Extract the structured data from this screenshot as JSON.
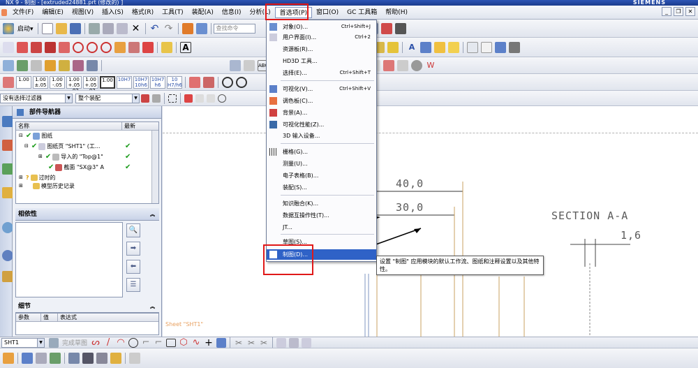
{
  "window": {
    "title": "NX 9 - 制图 - [extruded24881.prt (修改的) ]",
    "brand": "SIEMENS"
  },
  "menubar": [
    {
      "label": "文件(F)"
    },
    {
      "label": "编辑(E)"
    },
    {
      "label": "视图(V)"
    },
    {
      "label": "插入(S)"
    },
    {
      "label": "格式(R)"
    },
    {
      "label": "工具(T)"
    },
    {
      "label": "装配(A)"
    },
    {
      "label": "信息(I)"
    },
    {
      "label": "分析(L)"
    },
    {
      "label": "首选项(P)"
    },
    {
      "label": "窗口(O)"
    },
    {
      "label": "GC 工具箱"
    },
    {
      "label": "帮助(H)"
    }
  ],
  "toolbar1": {
    "start_label": "启动▾",
    "search_placeholder": "查找命令"
  },
  "toolbar3": {
    "dims": [
      "1.00",
      "1.00\n±.05",
      "1.00\n-.05",
      "1.00\n+.05\n-.02",
      "1.00\n+.05\n-.02",
      "1.00",
      "10H7",
      "10H7\n10h6",
      "10H7\nh6",
      "10\nH7/h6"
    ]
  },
  "filterbar": {
    "filter": "没有选择过滤器",
    "scope": "整个装配"
  },
  "navigator": {
    "title": "部件导航器",
    "columns": [
      "名称",
      "最新"
    ],
    "rows": [
      {
        "label": "图纸",
        "latest": ""
      },
      {
        "label": "图纸页 \"SHT1\" (工...",
        "latest": "✔"
      },
      {
        "label": "导入的 \"Top@1\"",
        "latest": "✔"
      },
      {
        "label": "截面 \"SX@3\" A",
        "latest": "✔"
      },
      {
        "label": "过时的",
        "latest": ""
      },
      {
        "label": "模型历史记录",
        "latest": ""
      }
    ]
  },
  "dependencies": {
    "title": "相依性"
  },
  "details": {
    "title": "细节",
    "columns": [
      "参数",
      "值",
      "表达式"
    ]
  },
  "drawing": {
    "dim1": "40,0",
    "dim2": "30,0",
    "section": "SECTION A-A",
    "dim3": "1,6",
    "sheet": "Sheet \"SHT1\""
  },
  "prefs_menu": {
    "items": [
      {
        "label": "对象(O)...",
        "shortcut": "Ctrl+Shift+J",
        "icon": "object-icon"
      },
      {
        "label": "用户界面(I)...",
        "shortcut": "Ctrl+2",
        "icon": "ui-icon"
      },
      {
        "label": "资源板(R)...",
        "shortcut": "",
        "icon": ""
      },
      {
        "label": "HD3D 工具...",
        "shortcut": "",
        "icon": ""
      },
      {
        "label": "选择(E)...",
        "shortcut": "Ctrl+Shift+T",
        "icon": ""
      },
      {
        "label": "可视化(V)...",
        "shortcut": "Ctrl+Shift+V",
        "icon": "visualization-icon"
      },
      {
        "label": "调色板(C)...",
        "shortcut": "",
        "icon": "palette-icon"
      },
      {
        "label": "背景(A)...",
        "shortcut": "",
        "icon": "background-icon"
      },
      {
        "label": "可视化性能(Z)...",
        "shortcut": "",
        "icon": "performance-icon"
      },
      {
        "label": "3D 输入设备...",
        "shortcut": "",
        "icon": ""
      },
      {
        "label": "栅格(G)...",
        "shortcut": "",
        "icon": "grid-icon"
      },
      {
        "label": "测量(U)...",
        "shortcut": "",
        "icon": ""
      },
      {
        "label": "电子表格(B)...",
        "shortcut": "",
        "icon": ""
      },
      {
        "label": "装配(S)...",
        "shortcut": "",
        "icon": ""
      },
      {
        "label": "知识融合(K)...",
        "shortcut": "",
        "icon": ""
      },
      {
        "label": "数据互操作性(T)...",
        "shortcut": "",
        "icon": ""
      },
      {
        "label": "JT...",
        "shortcut": "",
        "icon": ""
      },
      {
        "label": "草图(S)...",
        "shortcut": "",
        "icon": ""
      },
      {
        "label": "制图(D)...",
        "shortcut": "",
        "icon": "drafting-icon"
      }
    ]
  },
  "tooltip": "设置 \"制图\" 应用模块的默认工作流、图纸和注释设置以及其他特性。",
  "statusbar": {
    "sheet_select": "SHT1",
    "finish_sketch": "完成草图"
  }
}
